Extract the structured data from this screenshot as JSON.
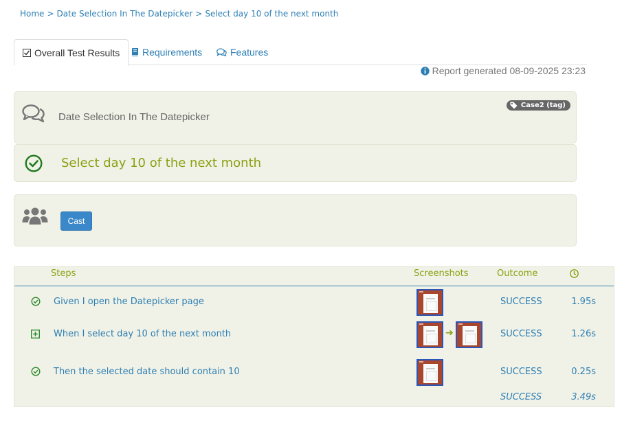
{
  "breadcrumb": {
    "home": "Home",
    "separator": ">",
    "feature": "Date Selection In The Datepicker",
    "current": "Select day 10 of the next month"
  },
  "tabs": [
    {
      "label": "Overall Test Results",
      "icon": "checkbox-icon",
      "active": true
    },
    {
      "label": "Requirements",
      "icon": "book-icon",
      "active": false
    },
    {
      "label": "Features",
      "icon": "comments-icon",
      "active": false
    }
  ],
  "report": {
    "text": "Report generated 08-09-2025 23:23",
    "icon": "info-circle-icon"
  },
  "feature": {
    "title": "Date Selection In The Datepicker",
    "tag": "Case2 (tag)",
    "icon": "comments-icon"
  },
  "scenario": {
    "title": "Select day 10 of the next month",
    "icon": "check-circle-icon"
  },
  "cast": {
    "button": "Cast",
    "icon": "users-icon"
  },
  "steps_table": {
    "headers": {
      "steps": "Steps",
      "screenshots": "Screenshots",
      "outcome": "Outcome",
      "time_icon": "clock-icon"
    },
    "rows": [
      {
        "icon": "check-circle-icon",
        "description": "Given I open the Datepicker page",
        "screenshots": 1,
        "outcome": "SUCCESS",
        "duration": "1.95s"
      },
      {
        "icon": "plus-square-icon",
        "description": "When I select day 10 of the next month",
        "screenshots": 2,
        "outcome": "SUCCESS",
        "duration": "1.26s"
      },
      {
        "icon": "check-circle-icon",
        "description": "Then the selected date should contain 10",
        "screenshots": 1,
        "outcome": "SUCCESS",
        "duration": "0.25s"
      }
    ],
    "summary": {
      "outcome": "SUCCESS",
      "duration": "3.49s"
    }
  },
  "colors": {
    "link": "#2d7fb3",
    "success_green": "#8aa012",
    "panel_bg": "#f1f2e7",
    "button_blue": "#3a87c9",
    "check_green": "#2e8b2e"
  }
}
